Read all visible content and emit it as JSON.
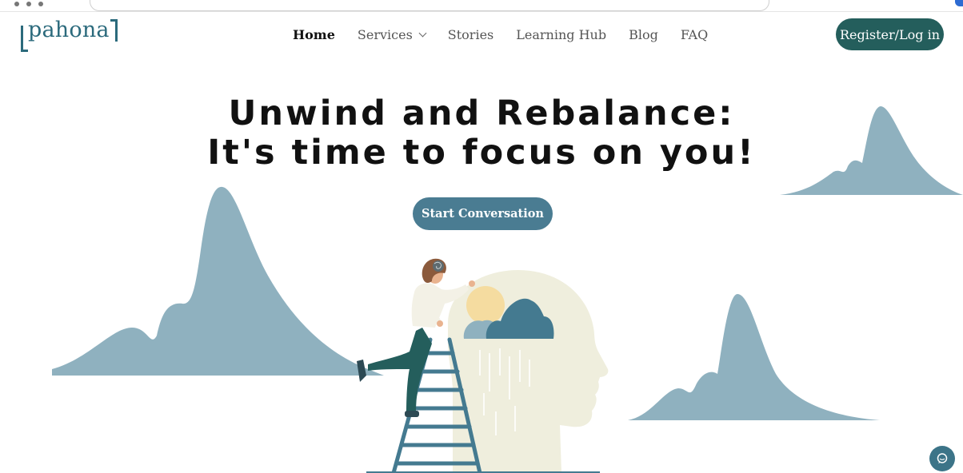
{
  "brand": {
    "logo_text": "pahona"
  },
  "nav": {
    "items": [
      {
        "label": "Home",
        "active": true
      },
      {
        "label": "Services",
        "has_dropdown": true
      },
      {
        "label": "Stories"
      },
      {
        "label": "Learning Hub"
      },
      {
        "label": "Blog"
      },
      {
        "label": "FAQ"
      }
    ],
    "register_label": "Register/Log in"
  },
  "hero": {
    "title_line1": "Unwind and Rebalance:",
    "title_line2": "It's time to focus on you!",
    "cta_label": "Start Conversation"
  },
  "icons": {
    "chevron": "chevron-down-icon",
    "chat": "chat-bubble-icon"
  },
  "colors": {
    "brand_teal": "#2b6a7c",
    "register_bg": "#245e5c",
    "cta_bg": "#4a7c92",
    "mountain": "#8fb1bf",
    "head_cream": "#efeedd",
    "cloud_dark": "#447a90",
    "sun": "#f5dca0"
  }
}
